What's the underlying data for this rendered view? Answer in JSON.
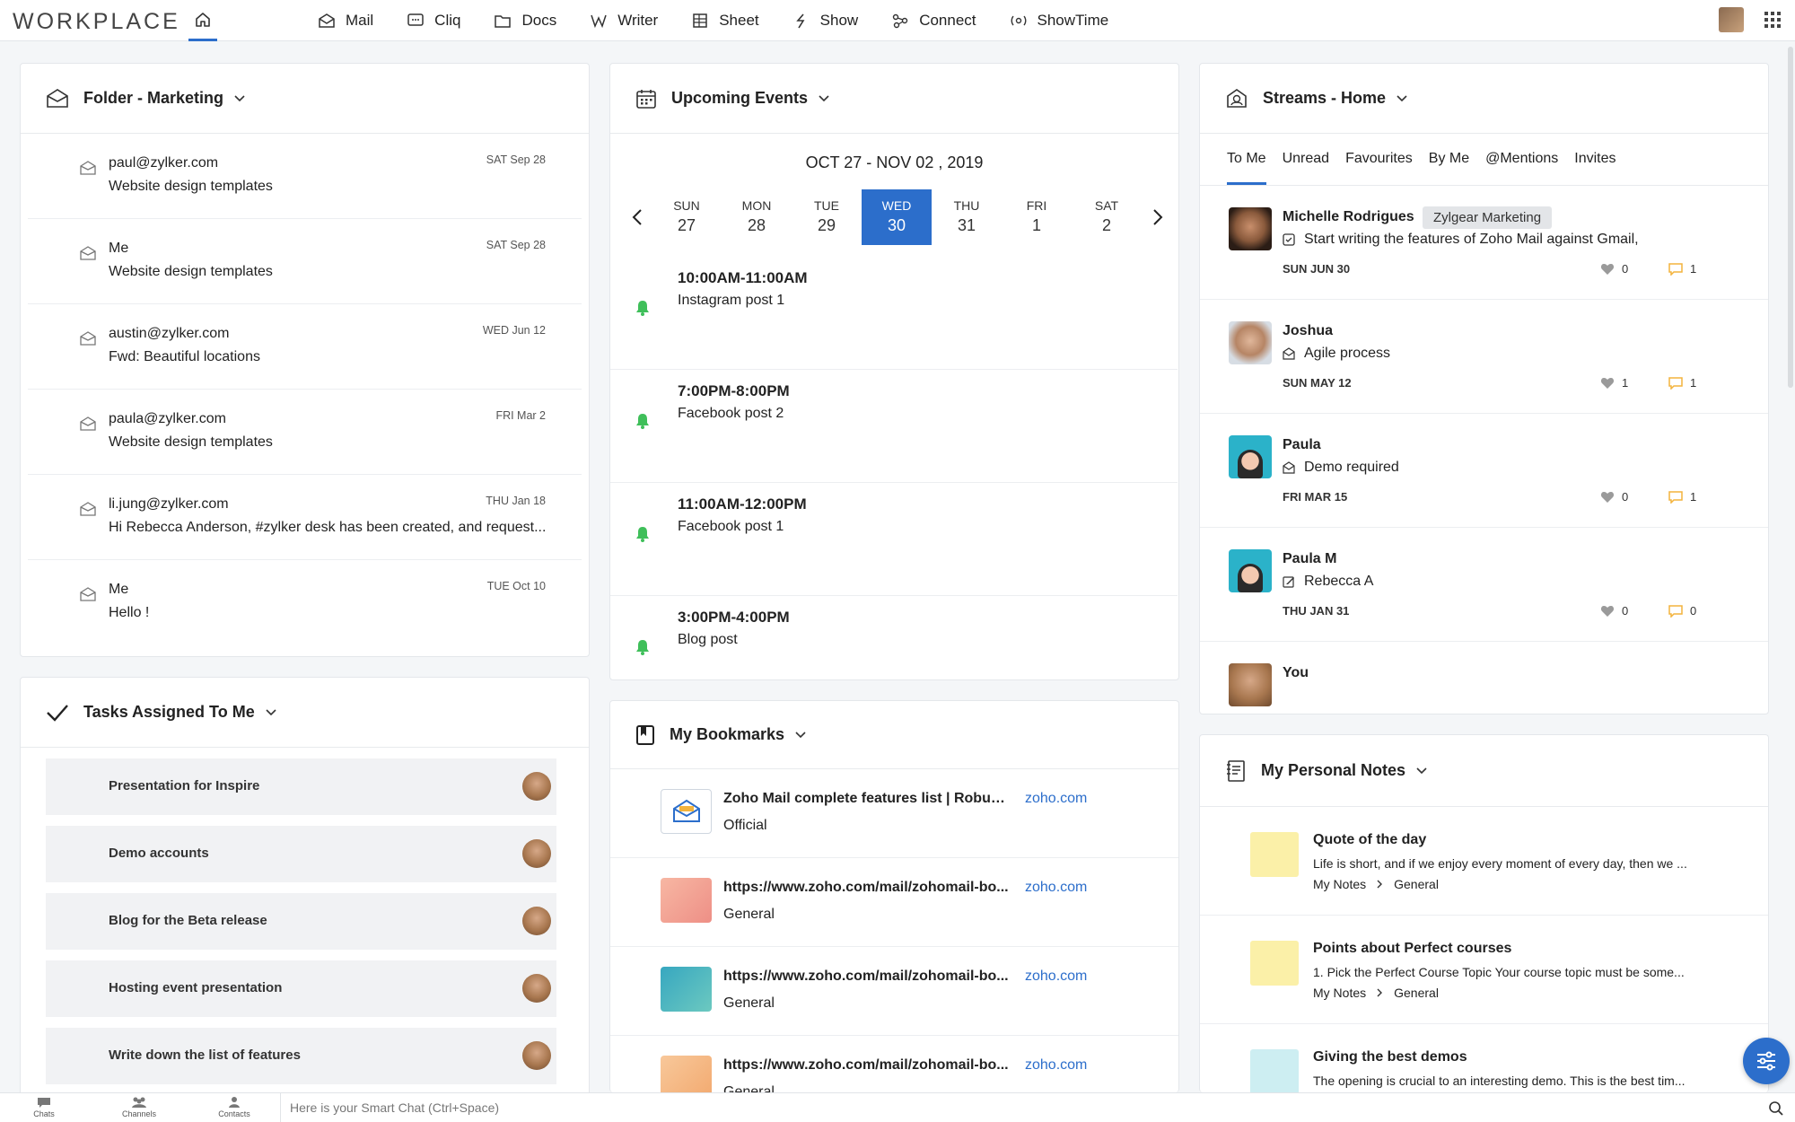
{
  "topbar": {
    "logo": "WORKPLACE",
    "apps": [
      {
        "label": "Mail",
        "icon": "mail-icon"
      },
      {
        "label": "Cliq",
        "icon": "chat-icon"
      },
      {
        "label": "Docs",
        "icon": "folder-icon"
      },
      {
        "label": "Writer",
        "icon": "writer-icon"
      },
      {
        "label": "Sheet",
        "icon": "sheet-icon"
      },
      {
        "label": "Show",
        "icon": "show-icon"
      },
      {
        "label": "Connect",
        "icon": "connect-icon"
      },
      {
        "label": "ShowTime",
        "icon": "showtime-icon"
      }
    ]
  },
  "folder": {
    "title": "Folder - Marketing",
    "mails": [
      {
        "from": "paul@zylker.com",
        "subject": "Website design templates",
        "date": "SAT Sep 28"
      },
      {
        "from": "Me",
        "subject": "Website design templates",
        "date": "SAT Sep 28"
      },
      {
        "from": "austin@zylker.com",
        "subject": "Fwd: Beautiful locations",
        "date": "WED Jun 12"
      },
      {
        "from": "paula@zylker.com",
        "subject": "Website design templates",
        "date": "FRI Mar 2"
      },
      {
        "from": "li.jung@zylker.com",
        "subject": "Hi Rebecca Anderson, #zylker desk has been created, and request...",
        "date": "THU Jan 18"
      },
      {
        "from": "Me",
        "subject": "Hello !",
        "date": "TUE Oct 10"
      }
    ]
  },
  "tasks": {
    "title": "Tasks Assigned To Me",
    "items": [
      "Presentation for Inspire",
      "Demo accounts",
      "Blog for the Beta release",
      "Hosting event presentation",
      "Write down the list of features"
    ]
  },
  "events": {
    "title": "Upcoming Events",
    "range": "OCT 27 - NOV 02 , 2019",
    "days": [
      {
        "name": "SUN",
        "num": "27"
      },
      {
        "name": "MON",
        "num": "28"
      },
      {
        "name": "TUE",
        "num": "29"
      },
      {
        "name": "WED",
        "num": "30"
      },
      {
        "name": "THU",
        "num": "31"
      },
      {
        "name": "FRI",
        "num": "1"
      },
      {
        "name": "SAT",
        "num": "2"
      }
    ],
    "selected_day": "WED 30",
    "items": [
      {
        "time": "10:00AM-11:00AM",
        "name": "Instagram post 1"
      },
      {
        "time": "7:00PM-8:00PM",
        "name": "Facebook post 2"
      },
      {
        "time": "11:00AM-12:00PM",
        "name": "Facebook post 1"
      },
      {
        "time": "3:00PM-4:00PM",
        "name": "Blog post"
      }
    ]
  },
  "bookmarks": {
    "title": "My Bookmarks",
    "items": [
      {
        "title": "Zoho Mail complete features list | Robust...",
        "domain": "zoho.com",
        "category": "Official",
        "color": "#ffffff"
      },
      {
        "title": "https://www.zoho.com/mail/zohomail-bo...",
        "domain": "zoho.com",
        "category": "General",
        "color": "#f2a49a"
      },
      {
        "title": "https://www.zoho.com/mail/zohomail-bo...",
        "domain": "zoho.com",
        "category": "General",
        "color": "#4fb4c4"
      },
      {
        "title": "https://www.zoho.com/mail/zohomail-bo...",
        "domain": "zoho.com",
        "category": "General",
        "color": "#f6c08f"
      }
    ]
  },
  "streams": {
    "title": "Streams - Home",
    "tabs": [
      "To Me",
      "Unread",
      "Favourites",
      "By Me",
      "@Mentions",
      "Invites"
    ],
    "active_tab": "To Me",
    "items": [
      {
        "name": "Michelle Rodrigues",
        "tag": "Zylgear Marketing",
        "text": "Start writing the features of Zoho Mail against Gmail,",
        "icon": "task-icon",
        "date": "SUN JUN 30",
        "likes": "0",
        "comments": "1"
      },
      {
        "name": "Joshua",
        "tag": "",
        "text": "Agile process",
        "icon": "mail-icon",
        "date": "SUN MAY 12",
        "likes": "1",
        "comments": "1"
      },
      {
        "name": "Paula",
        "tag": "",
        "text": "Demo required",
        "icon": "mail-icon",
        "date": "FRI MAR 15",
        "likes": "0",
        "comments": "1"
      },
      {
        "name": "Paula M",
        "tag": "",
        "text": "Rebecca A",
        "icon": "edit-icon",
        "date": "THU JAN 31",
        "likes": "0",
        "comments": "0"
      },
      {
        "name": "You",
        "tag": "",
        "text": "",
        "icon": "",
        "date": "",
        "likes": "",
        "comments": ""
      }
    ]
  },
  "notes": {
    "title": "My Personal Notes",
    "items": [
      {
        "title": "Quote of the day",
        "body": "Life is short, and if we enjoy every moment of every day, then we ...",
        "folder": "My Notes",
        "sub": "General",
        "color": "#fbf0a8"
      },
      {
        "title": "Points about Perfect courses",
        "body": "1. Pick the Perfect Course Topic Your course topic must be some...",
        "folder": "My Notes",
        "sub": "General",
        "color": "#fbf0a8"
      },
      {
        "title": "Giving the best demos",
        "body": "The opening is crucial to an interesting demo. This is the best tim...",
        "folder": "",
        "sub": "",
        "color": "#cdeef2"
      }
    ]
  },
  "bottombar": {
    "items": [
      "Chats",
      "Channels",
      "Contacts"
    ],
    "chat_placeholder": "Here is your Smart Chat (Ctrl+Space)"
  },
  "colors": {
    "accent": "#2c6ecb",
    "bell": "#3fbf5a",
    "comment": "#f3b33d"
  }
}
